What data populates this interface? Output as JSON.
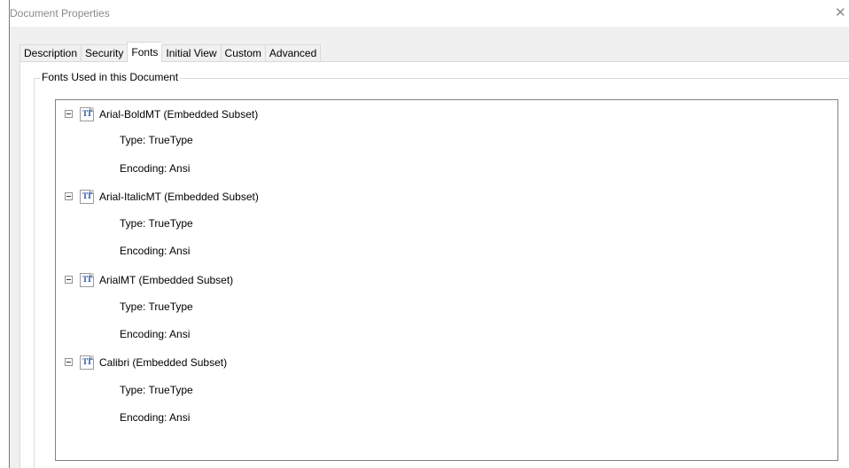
{
  "window": {
    "title": "Document Properties",
    "close_glyph": "✕"
  },
  "tabs": [
    {
      "label": "Description",
      "active": false
    },
    {
      "label": "Security",
      "active": false
    },
    {
      "label": "Fonts",
      "active": true
    },
    {
      "label": "Initial View",
      "active": false
    },
    {
      "label": "Custom",
      "active": false
    },
    {
      "label": "Advanced",
      "active": false
    }
  ],
  "group": {
    "label": "Fonts Used in this Document"
  },
  "fonts": [
    {
      "name": "Arial-BoldMT (Embedded Subset)",
      "type": "Type: TrueType",
      "encoding": "Encoding: Ansi"
    },
    {
      "name": "Arial-ItalicMT (Embedded Subset)",
      "type": "Type: TrueType",
      "encoding": "Encoding: Ansi"
    },
    {
      "name": "ArialMT (Embedded Subset)",
      "type": "Type: TrueType",
      "encoding": "Encoding: Ansi"
    },
    {
      "name": "Calibri (Embedded Subset)",
      "type": "Type: TrueType",
      "encoding": "Encoding: Ansi"
    }
  ],
  "icons": {
    "font_icon": "truetype-font-icon",
    "tree_toggle": "collapse-minus-icon"
  }
}
